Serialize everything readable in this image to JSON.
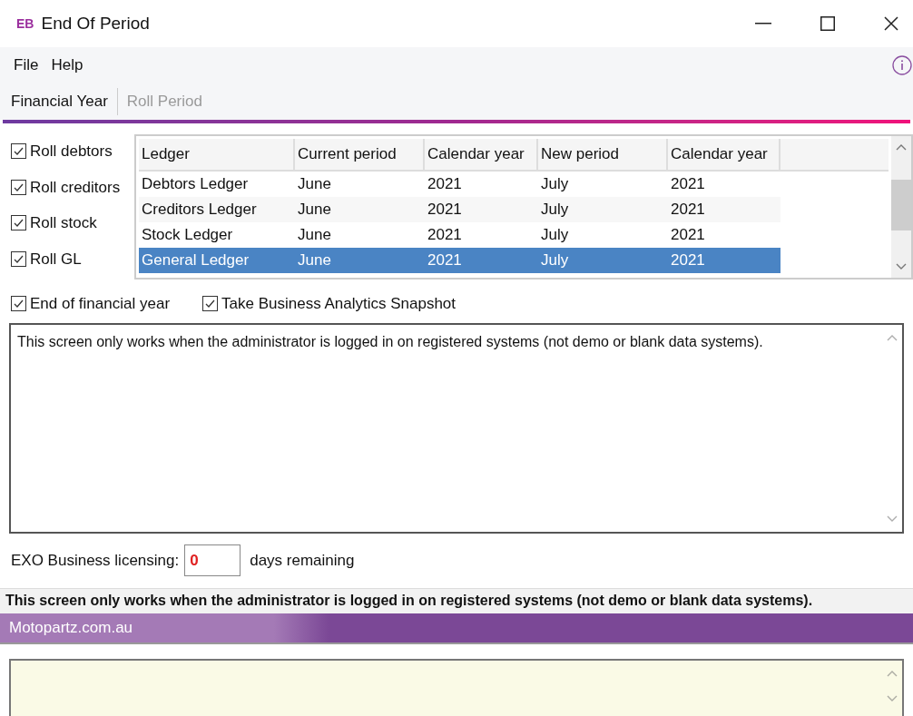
{
  "window": {
    "logo": "EB",
    "title": "End Of Period"
  },
  "menu": [
    "File",
    "Help"
  ],
  "tabs": [
    {
      "label": "Financial Year",
      "disabled": false
    },
    {
      "label": "Roll Period",
      "disabled": true
    }
  ],
  "roll_options": [
    {
      "label": "Roll debtors",
      "checked": true
    },
    {
      "label": "Roll creditors",
      "checked": true
    },
    {
      "label": "Roll stock",
      "checked": true
    },
    {
      "label": "Roll GL",
      "checked": true
    }
  ],
  "table": {
    "columns": [
      "Ledger",
      "Current period",
      "Calendar year",
      "New period",
      "Calendar year"
    ],
    "rows": [
      {
        "cells": [
          "Debtors Ledger",
          "June",
          "2021",
          "July",
          "2021"
        ],
        "selected": false
      },
      {
        "cells": [
          "Creditors Ledger",
          "June",
          "2021",
          "July",
          "2021"
        ],
        "selected": false
      },
      {
        "cells": [
          "Stock Ledger",
          "June",
          "2021",
          "July",
          "2021"
        ],
        "selected": false
      },
      {
        "cells": [
          "General Ledger",
          "June",
          "2021",
          "July",
          "2021"
        ],
        "selected": true
      }
    ]
  },
  "options": [
    {
      "label": "End of financial year",
      "checked": true
    },
    {
      "label": "Take Business Analytics Snapshot",
      "checked": true
    }
  ],
  "message": "This screen only works when the administrator is logged in on registered systems (not demo or blank data systems).",
  "licensing": {
    "label": "EXO Business licensing:",
    "value": "0",
    "suffix": "days remaining"
  },
  "status_text": "This screen only works when the administrator is logged in on registered systems (not demo or blank data systems).",
  "company_bar": "Motopartz.com.au"
}
